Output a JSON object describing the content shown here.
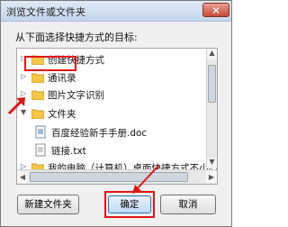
{
  "title": "浏览文件或文件夹",
  "close_glyph": "✕",
  "prompt": "从下面选择快捷方式的目标:",
  "tree": {
    "items": [
      {
        "label": "创建快捷方式",
        "type": "folder"
      },
      {
        "label": "通讯录",
        "type": "folder"
      },
      {
        "label": "图片文字识别",
        "type": "folder"
      },
      {
        "label": "文件夹",
        "type": "folder",
        "selected": true
      },
      {
        "label": "百度经验新手手册.doc",
        "type": "file"
      },
      {
        "label": "链接.txt",
        "type": "file"
      },
      {
        "label": "我的电脑（计算机）桌面快捷方式不小心删",
        "type": "folder"
      },
      {
        "label": "",
        "type": "folder"
      }
    ]
  },
  "buttons": {
    "new_folder": "新建文件夹",
    "ok": "确定",
    "cancel": "取消"
  },
  "colors": {
    "highlight_red": "#e01616",
    "folder_yellow": "#f4c64a"
  }
}
